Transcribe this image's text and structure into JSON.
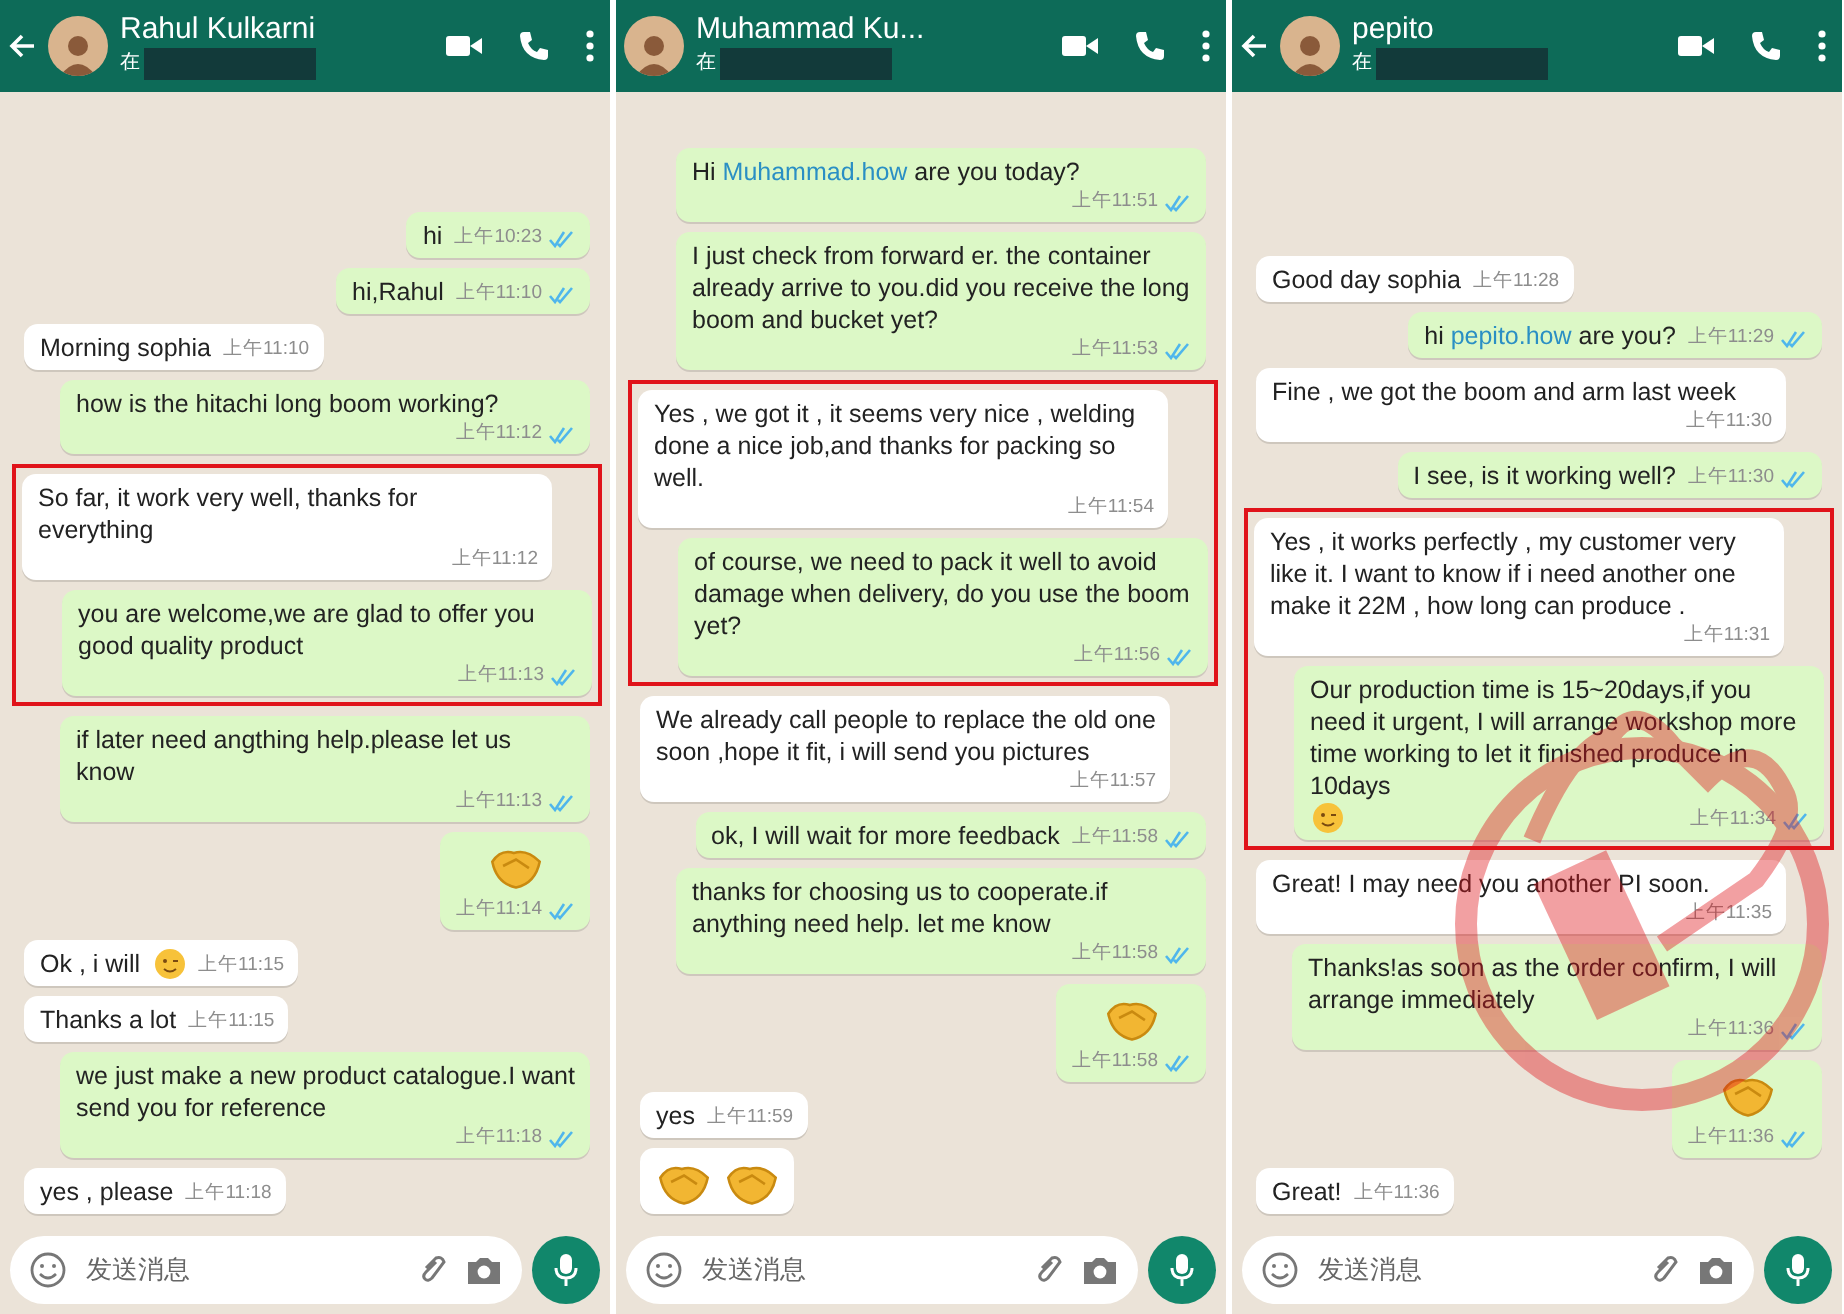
{
  "panels": [
    {
      "contact": {
        "name": "Rahul Kulkarni",
        "status": "在"
      },
      "back_arrow": true,
      "stamp": false,
      "composer": {
        "placeholder": "发送消息"
      },
      "messages": [
        {
          "outgoing": true,
          "kind": "text",
          "text": "hi",
          "time": "上午10:23",
          "read": true,
          "highlighted": false
        },
        {
          "outgoing": true,
          "kind": "text",
          "text": "hi,Rahul",
          "time": "上午11:10",
          "read": true,
          "highlighted": false
        },
        {
          "outgoing": false,
          "kind": "text",
          "text": "Morning sophia",
          "time": "上午11:10",
          "highlighted": false
        },
        {
          "outgoing": true,
          "kind": "text",
          "text": "how is the hitachi long boom working?",
          "time": "上午11:12",
          "read": true,
          "highlighted": false
        },
        {
          "outgoing": false,
          "kind": "text",
          "text": "So far, it work very well, thanks for everything",
          "time": "上午11:12",
          "highlighted": true
        },
        {
          "outgoing": true,
          "kind": "text",
          "text": "you are welcome,we are glad to offer you good quality product",
          "time": "上午11:13",
          "read": true,
          "highlighted": true
        },
        {
          "outgoing": true,
          "kind": "text",
          "text": "if later need angthing help.please let us know",
          "time": "上午11:13",
          "read": true,
          "highlighted": false
        },
        {
          "outgoing": true,
          "kind": "emoji",
          "time": "上午11:14",
          "read": true,
          "highlighted": false
        },
        {
          "outgoing": false,
          "kind": "text",
          "text": "Ok , i will",
          "trailing_emoji": true,
          "time": "上午11:15",
          "highlighted": false
        },
        {
          "outgoing": false,
          "kind": "text",
          "text": "Thanks a lot",
          "time": "上午11:15",
          "highlighted": false
        },
        {
          "outgoing": true,
          "kind": "text",
          "text": "we just make a new product catalogue.I want send you for reference",
          "time": "上午11:18",
          "read": true,
          "highlighted": false
        },
        {
          "outgoing": false,
          "kind": "text",
          "text": "yes , please",
          "time": "上午11:18",
          "highlighted": false
        }
      ]
    },
    {
      "contact": {
        "name": "Muhammad Ku...",
        "status": "在"
      },
      "back_arrow": false,
      "stamp": false,
      "composer": {
        "placeholder": "发送消息"
      },
      "messages": [
        {
          "outgoing": true,
          "kind": "text",
          "parts": [
            {
              "kind": "plain",
              "text": "Hi "
            },
            {
              "kind": "link",
              "text": "Muhammad.how"
            },
            {
              "kind": "plain",
              "text": " are you today?"
            }
          ],
          "time": "上午11:51",
          "read": true,
          "highlighted": false
        },
        {
          "outgoing": true,
          "kind": "text",
          "text": "I just check from forward er. the container already arrive to you.did you receive the long boom and bucket yet?",
          "time": "上午11:53",
          "read": true,
          "highlighted": false
        },
        {
          "outgoing": false,
          "kind": "text",
          "text": "Yes , we got it , it seems very nice , welding done a nice job,and thanks for packing so well.",
          "time": "上午11:54",
          "highlighted": true
        },
        {
          "outgoing": true,
          "kind": "text",
          "text": "of course,  we need to pack it well to avoid damage when delivery,  do you use the boom yet?",
          "time": "上午11:56",
          "read": true,
          "highlighted": true
        },
        {
          "outgoing": false,
          "kind": "text",
          "text": "We already call people to replace the old one soon ,hope it fit, i will send you pictures",
          "time": "上午11:57",
          "highlighted": false
        },
        {
          "outgoing": true,
          "kind": "text",
          "text": "ok,  I will wait for more feedback",
          "time": "上午11:58",
          "read": true,
          "highlighted": false
        },
        {
          "outgoing": true,
          "kind": "text",
          "text": "thanks for choosing us to cooperate.if anything need help. let me know",
          "time": "上午11:58",
          "read": true,
          "highlighted": false
        },
        {
          "outgoing": true,
          "kind": "emoji",
          "time": "上午11:58",
          "read": true,
          "highlighted": false
        },
        {
          "outgoing": false,
          "kind": "text",
          "text": "yes",
          "time": "上午11:59",
          "highlighted": false
        },
        {
          "outgoing": false,
          "kind": "emoji-pair",
          "highlighted": false
        }
      ]
    },
    {
      "contact": {
        "name": "pepito",
        "status": "在"
      },
      "back_arrow": true,
      "stamp": true,
      "composer": {
        "placeholder": "发送消息"
      },
      "messages": [
        {
          "outgoing": false,
          "kind": "text",
          "text": "Good day sophia",
          "time": "上午11:28",
          "highlighted": false
        },
        {
          "outgoing": true,
          "kind": "text",
          "parts": [
            {
              "kind": "plain",
              "text": "hi "
            },
            {
              "kind": "link",
              "text": "pepito.how"
            },
            {
              "kind": "plain",
              "text": " are you?"
            }
          ],
          "time": "上午11:29",
          "read": true,
          "highlighted": false
        },
        {
          "outgoing": false,
          "kind": "text",
          "text": "Fine , we got the boom and arm last week",
          "time": "上午11:30",
          "highlighted": false
        },
        {
          "outgoing": true,
          "kind": "text",
          "text": "I see,  is it working well?",
          "time": "上午11:30",
          "read": true,
          "highlighted": false
        },
        {
          "outgoing": false,
          "kind": "text",
          "text": "Yes , it works perfectly , my customer very like it. I want to know if i need another one make it 22M , how long can produce .",
          "time": "上午11:31",
          "highlighted": true
        },
        {
          "outgoing": true,
          "kind": "text",
          "text": "Our production time is 15~20days,if you need it urgent, I will arrange workshop more time working to let it finished produce in 10days",
          "trailing_emoji": true,
          "time": "上午11:34",
          "read": true,
          "highlighted": true
        },
        {
          "outgoing": false,
          "kind": "text",
          "text": "Great! I may need you another PI soon.",
          "time": "上午11:35",
          "highlighted": false
        },
        {
          "outgoing": true,
          "kind": "text",
          "text": "Thanks!as soon as the order confirm,  I will arrange immediately",
          "time": "上午11:36",
          "read": true,
          "highlighted": false
        },
        {
          "outgoing": true,
          "kind": "emoji",
          "time": "上午11:36",
          "read": true,
          "highlighted": false
        },
        {
          "outgoing": false,
          "kind": "text",
          "text": "Great!",
          "time": "上午11:36",
          "highlighted": false
        }
      ]
    }
  ]
}
